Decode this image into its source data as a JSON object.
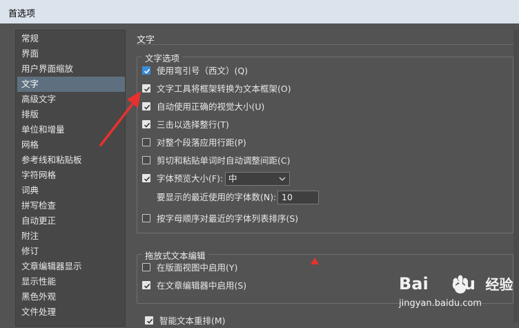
{
  "window": {
    "title": "首选项"
  },
  "sidebar": {
    "items": [
      {
        "label": "常规"
      },
      {
        "label": "界面"
      },
      {
        "label": "用户界面缩放"
      },
      {
        "label": "文字",
        "selected": true
      },
      {
        "label": "高级文字"
      },
      {
        "label": "排版"
      },
      {
        "label": "单位和增量"
      },
      {
        "label": "网格"
      },
      {
        "label": "参考线和粘贴板"
      },
      {
        "label": "字符网格"
      },
      {
        "label": "词典"
      },
      {
        "label": "拼写检查"
      },
      {
        "label": "自动更正"
      },
      {
        "label": "附注"
      },
      {
        "label": "修订"
      },
      {
        "label": "文章编辑器显示"
      },
      {
        "label": "显示性能"
      },
      {
        "label": "黑色外观"
      },
      {
        "label": "文件处理"
      }
    ]
  },
  "content": {
    "heading": "文字",
    "text_options": {
      "title": "文字选项",
      "options": [
        {
          "label": "使用弯引号（西文）(Q)",
          "checked": true
        },
        {
          "label": "文字工具将框架转换为文本框架(O)",
          "checked": true
        },
        {
          "label": "自动使用正确的视觉大小(U)",
          "checked": true
        },
        {
          "label": "三击以选择整行(T)",
          "checked": true
        },
        {
          "label": "对整个段落应用行距(P)",
          "checked": false
        },
        {
          "label": "剪切和粘贴单词时自动调整间距(C)",
          "checked": false
        },
        {
          "label": "字体预览大小(F):",
          "checked": true
        },
        {
          "label": "按字母顺序对最近的字体列表排序(S)",
          "checked": false
        }
      ],
      "font_preview_size": "中",
      "recent_fonts_label": "要显示的最近使用的字体数(N):",
      "recent_fonts_value": "10"
    },
    "drag_drop": {
      "title": "拖放式文本编辑",
      "options": [
        {
          "label": "在版面视图中启用(Y)",
          "checked": false
        },
        {
          "label": "在文章编辑器中启用(S)",
          "checked": true
        }
      ]
    },
    "smart_reflow": {
      "label": "智能文本重排(M)",
      "checked": true
    }
  },
  "watermark": {
    "brand_left": "Bai",
    "brand_right": "du",
    "brand_cn": "经验",
    "site": "jingyan.baidu.com"
  },
  "colors": {
    "annotation_red": "#e8312f",
    "accent_blue": "#3b8fd8"
  }
}
